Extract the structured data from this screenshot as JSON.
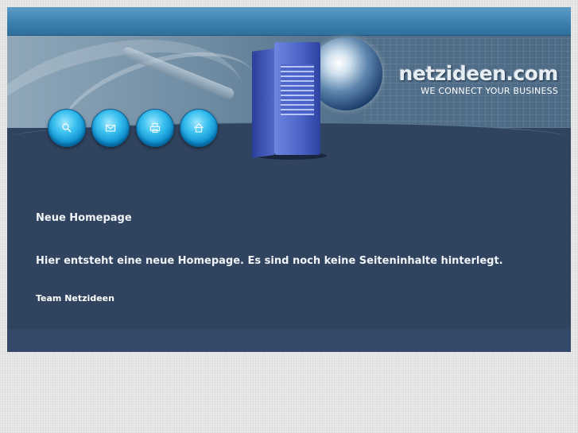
{
  "header": {
    "brand_name": "netzideen.com",
    "tagline": "WE CONNECT YOUR BUSINESS"
  },
  "nav": {
    "buttons": [
      {
        "icon": "search-icon"
      },
      {
        "icon": "mail-icon"
      },
      {
        "icon": "printer-icon"
      },
      {
        "icon": "home-icon"
      }
    ]
  },
  "main": {
    "heading": "Neue Homepage",
    "paragraph": "Hier entsteht eine neue Homepage. Es sind noch keine Seiteninhalte hinterlegt.",
    "signature": "Team Netzideen"
  },
  "colors": {
    "page_background": "#e9e9e9",
    "frame_background": "#31445f",
    "topbar": "#3a7fac",
    "button_accent": "#0b8fd0"
  }
}
